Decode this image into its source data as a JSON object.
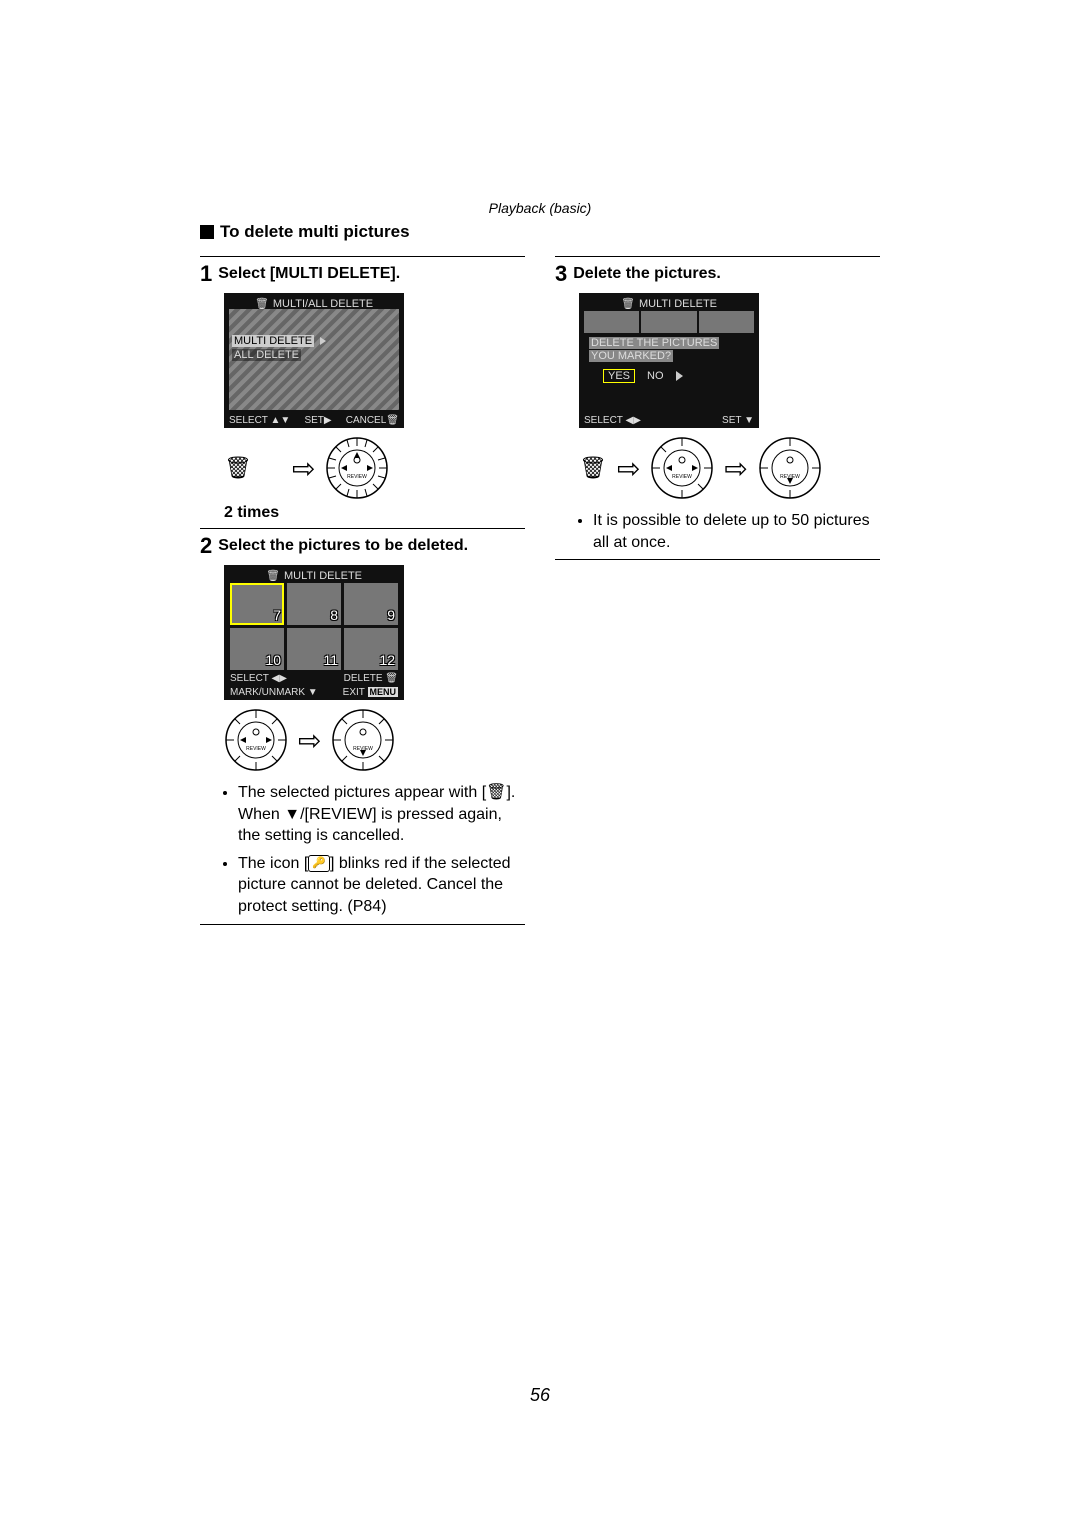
{
  "chapter": "Playback (basic)",
  "heading": "To delete multi pictures",
  "page_number": "56",
  "step1": {
    "num": "1",
    "title": "Select [MULTI DELETE].",
    "lcd_title": "MULTI/ALL DELETE",
    "option1": "MULTI DELETE",
    "option2": "ALL DELETE",
    "footer_select": "SELECT",
    "footer_set": "SET",
    "footer_cancel": "CANCEL",
    "two_times": "2 times"
  },
  "step2": {
    "num": "2",
    "title": "Select the pictures to be deleted.",
    "lcd_title": "MULTI DELETE",
    "thumbs": [
      "7",
      "8",
      "9",
      "10",
      "11",
      "12"
    ],
    "footer_select": "SELECT",
    "footer_delete": "DELETE",
    "footer_mark": "MARK/UNMARK",
    "footer_exit": "EXIT",
    "footer_exit_badge": "MENU",
    "note1_a": "The selected pictures appear with [",
    "note1_b": "]. When ▼/[REVIEW] is pressed again, the setting is cancelled.",
    "note2_a": "The icon [",
    "note2_b": "] blinks red if the selected picture cannot be deleted. Cancel the protect setting. (P84)"
  },
  "step3": {
    "num": "3",
    "title": "Delete the pictures.",
    "lcd_title": "MULTI DELETE",
    "msg_line1": "DELETE THE PICTURES",
    "msg_line2": "YOU MARKED?",
    "yes": "YES",
    "no": "NO",
    "footer_select": "SELECT",
    "footer_set": "SET",
    "note": "It is possible to delete up to 50 pictures all at once."
  },
  "dial_label": "REVIEW"
}
